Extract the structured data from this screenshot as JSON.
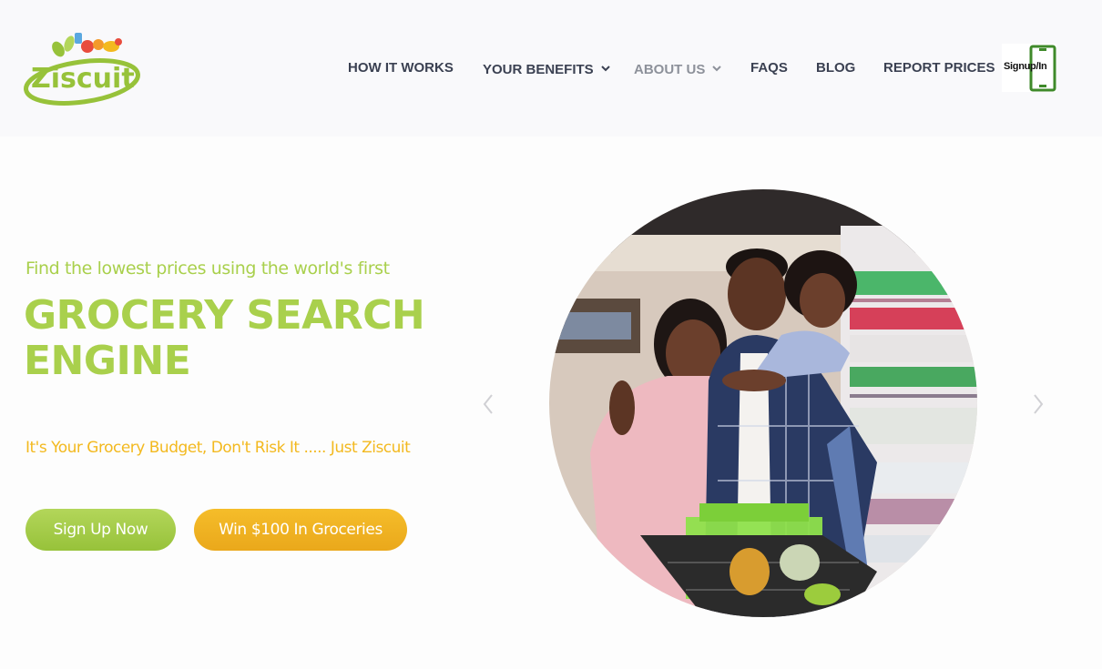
{
  "brand": {
    "name": "Ziscuit"
  },
  "nav": {
    "items": [
      {
        "label": "HOW IT WORKS"
      },
      {
        "label": "YOUR BENEFITS"
      },
      {
        "label": "ABOUT US"
      },
      {
        "label": "FAQS"
      },
      {
        "label": "BLOG"
      },
      {
        "label": "REPORT PRICES"
      }
    ],
    "signup_label": "Signup/In"
  },
  "hero": {
    "subtitle": "Find the lowest prices using the world's first",
    "title_line1": "GROCERY SEARCH",
    "title_line2": "ENGINE",
    "tagline": "It's Your Grocery Budget, Don't Risk It ..... Just Ziscuit",
    "cta_primary": "Sign Up Now",
    "cta_secondary": "Win $100 In Groceries"
  },
  "colors": {
    "brand_green": "#a9d04c",
    "brand_yellow": "#f3b91f",
    "nav_text": "#3b4152",
    "nav_muted": "#8d919a",
    "phone_green": "#3f8a2a"
  },
  "icons": {
    "prev": "chevron-left-icon",
    "next": "chevron-right-icon",
    "dropdown": "chevron-down-icon",
    "signup": "phone-icon"
  }
}
